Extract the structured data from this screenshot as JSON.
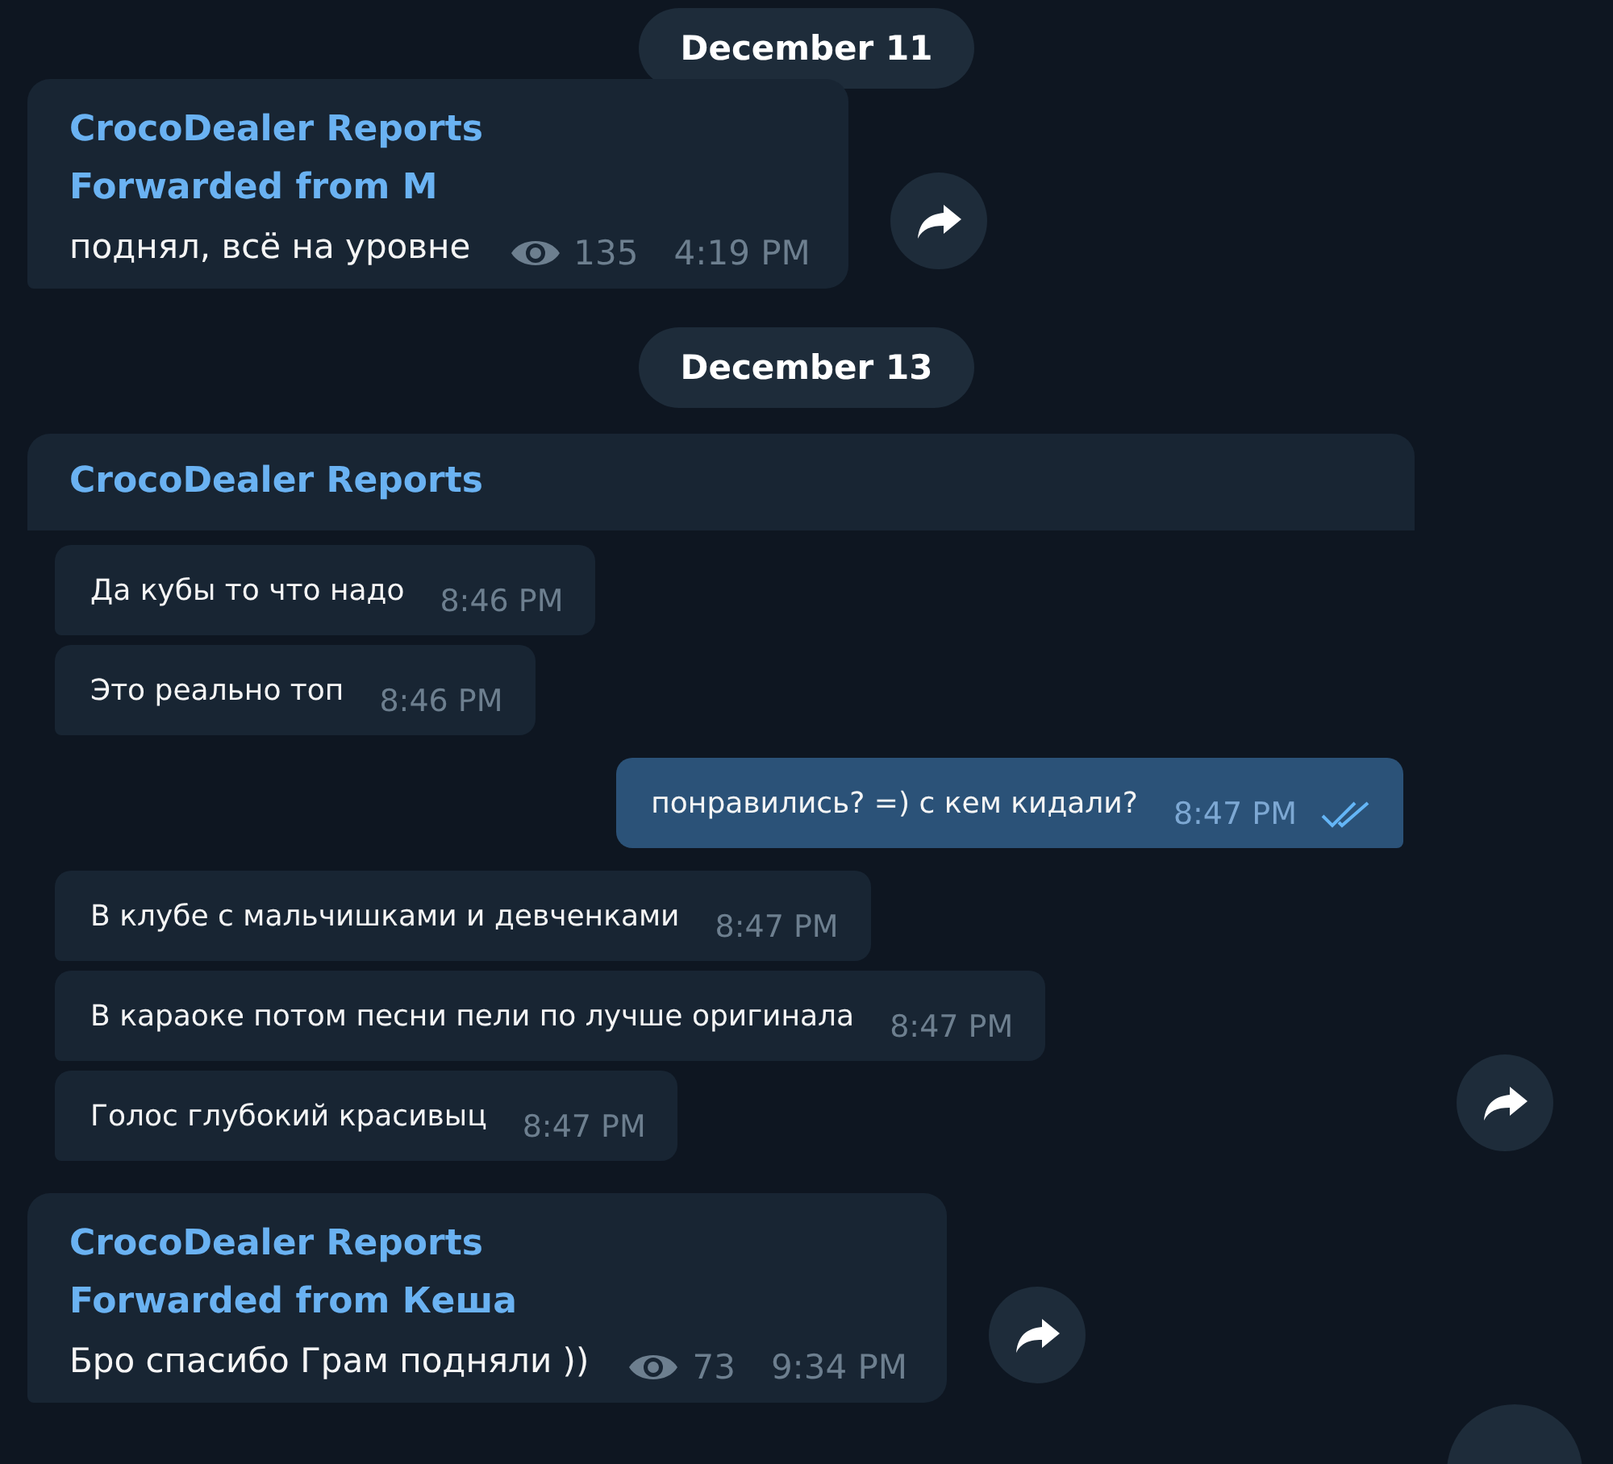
{
  "items": [
    {
      "kind": "date",
      "label": "December 11"
    },
    {
      "kind": "post",
      "channel": "CrocoDealer Reports",
      "forwarded_from": "Forwarded from M",
      "text": "поднял, всё на уровне",
      "views": "135",
      "time": "4:19 PM"
    },
    {
      "kind": "date",
      "label": "December 13"
    },
    {
      "kind": "thread",
      "channel": "CrocoDealer Reports",
      "messages": [
        {
          "text": "Да кубы то что надо",
          "time": "8:46 PM",
          "outgoing": false
        },
        {
          "text": "Это реально топ",
          "time": "8:46 PM",
          "outgoing": false
        },
        {
          "text": "понравились? =) с кем кидали?",
          "time": "8:47 PM",
          "outgoing": true,
          "read": true
        },
        {
          "text": "В клубе с мальчишками и девченками",
          "time": "8:47 PM",
          "outgoing": false
        },
        {
          "text": "В караоке потом песни пели по лучше оригинала",
          "time": "8:47 PM",
          "outgoing": false
        },
        {
          "text": "Голос глубокий красивыц",
          "time": "8:47 PM",
          "outgoing": false
        }
      ]
    },
    {
      "kind": "post",
      "channel": "CrocoDealer Reports",
      "forwarded_from": "Forwarded from Кеша",
      "text": "Бро спасибо Грам подняли ))",
      "views": "73",
      "time": "9:34 PM"
    }
  ]
}
